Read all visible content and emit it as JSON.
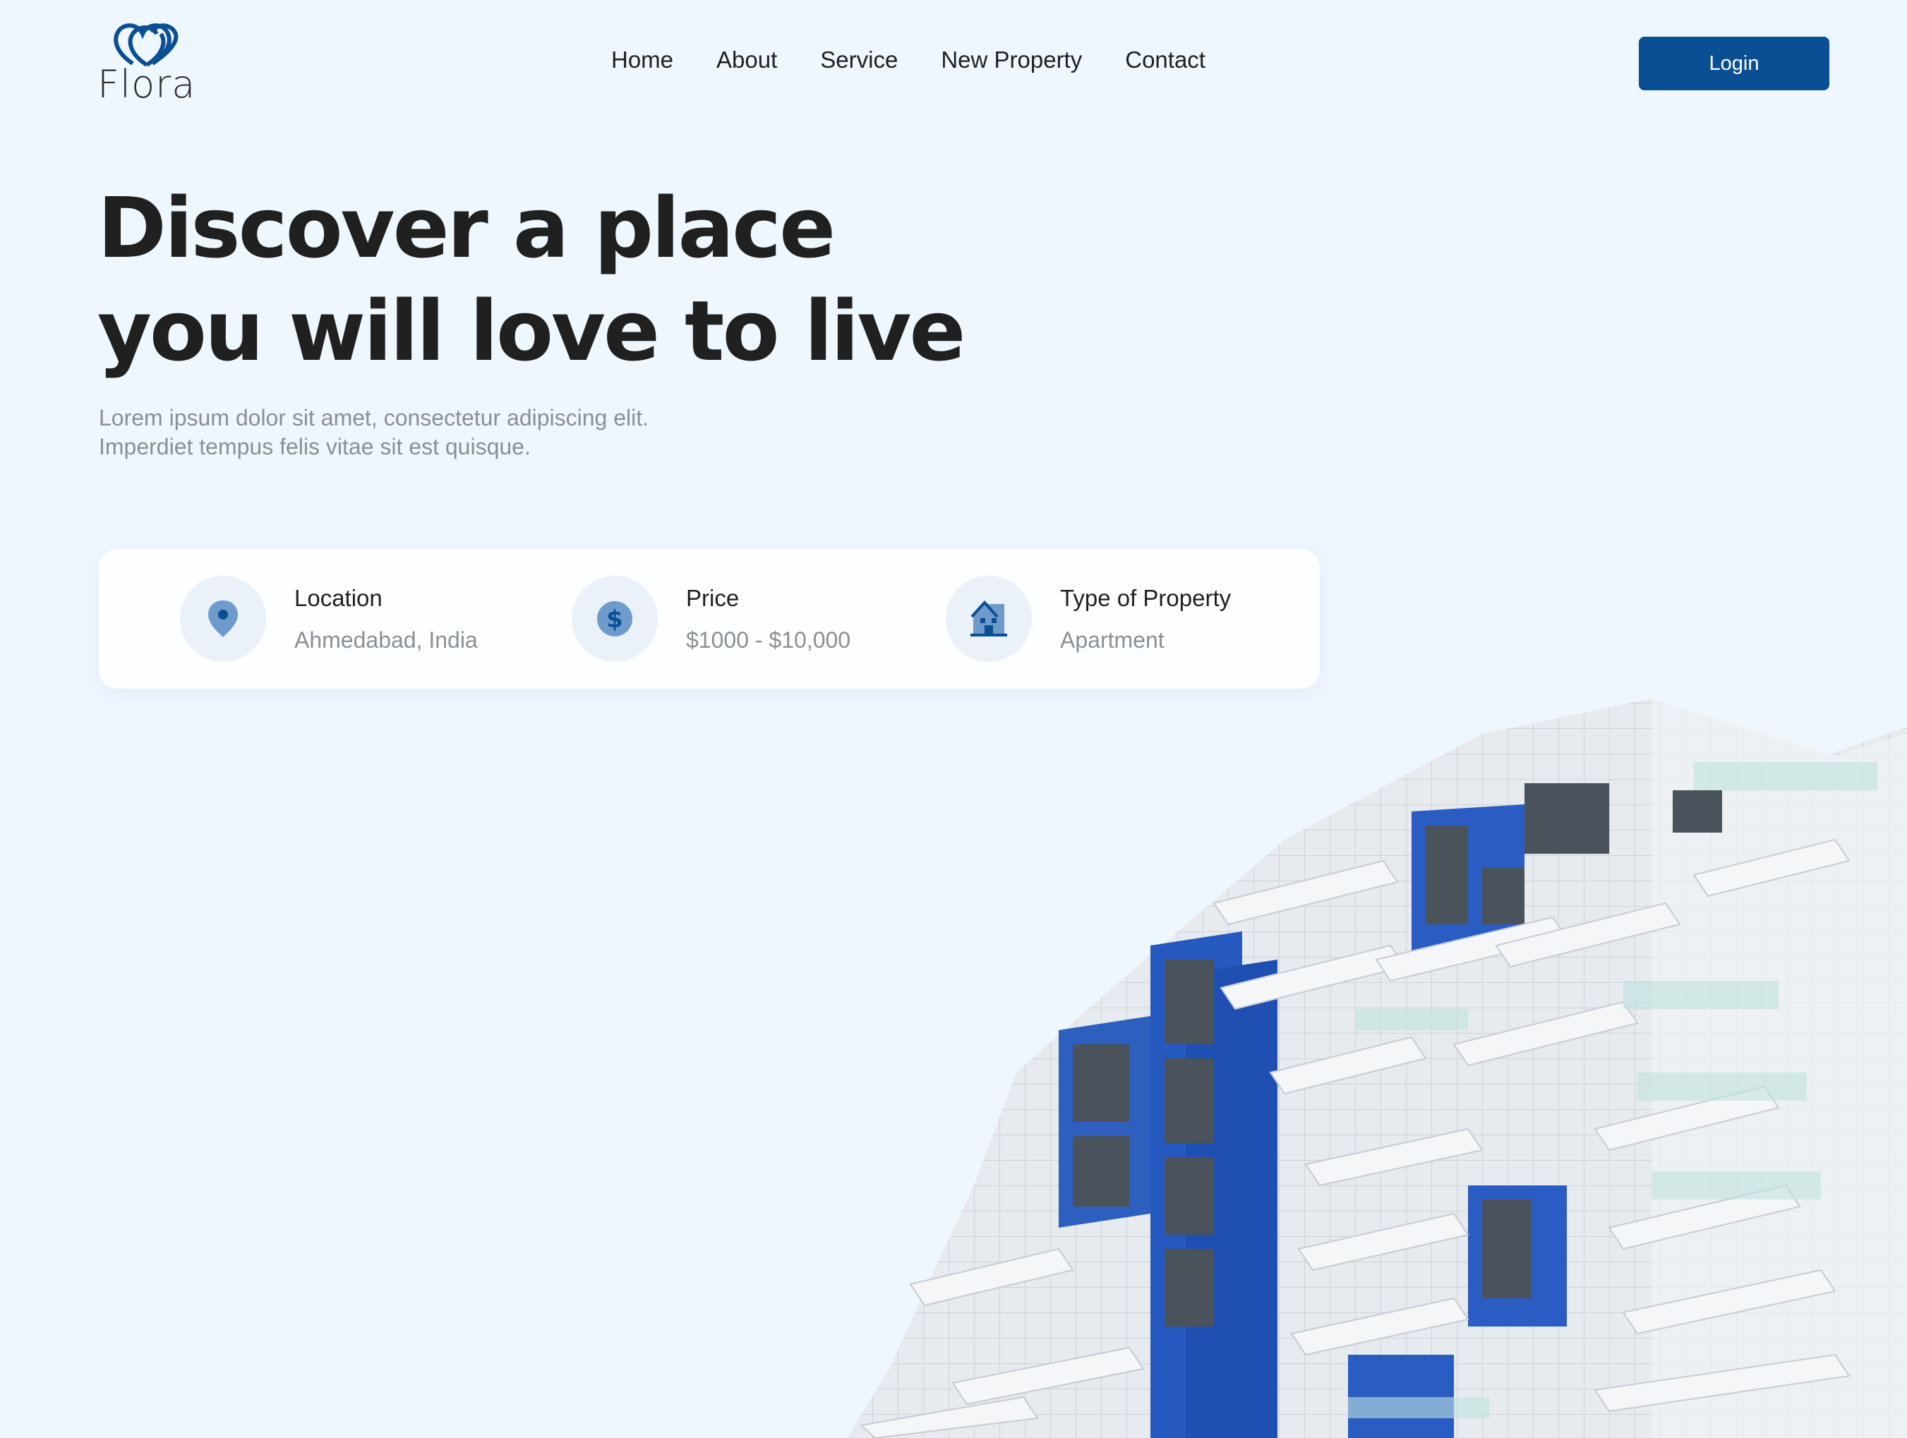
{
  "brand": {
    "name": "Flora",
    "color": "#0a4f93"
  },
  "nav": {
    "items": [
      {
        "label": "Home"
      },
      {
        "label": "About"
      },
      {
        "label": "Service"
      },
      {
        "label": "New Property"
      },
      {
        "label": "Contact"
      }
    ]
  },
  "header": {
    "login_label": "Login"
  },
  "hero": {
    "title_line1": "Discover a place",
    "title_line2": "you will love to live",
    "desc_line1": "Lorem ipsum dolor sit amet, consectetur adipiscing elit.",
    "desc_line2": "Imperdiet tempus felis vitae sit est quisque."
  },
  "search": {
    "location": {
      "label": "Location",
      "value": "Ahmedabad, India",
      "icon": "location-pin-icon"
    },
    "price": {
      "label": "Price",
      "value": "$1000 - $10,000",
      "icon": "dollar-icon"
    },
    "type": {
      "label": "Type of Property",
      "value": "Apartment",
      "icon": "house-icon"
    }
  }
}
